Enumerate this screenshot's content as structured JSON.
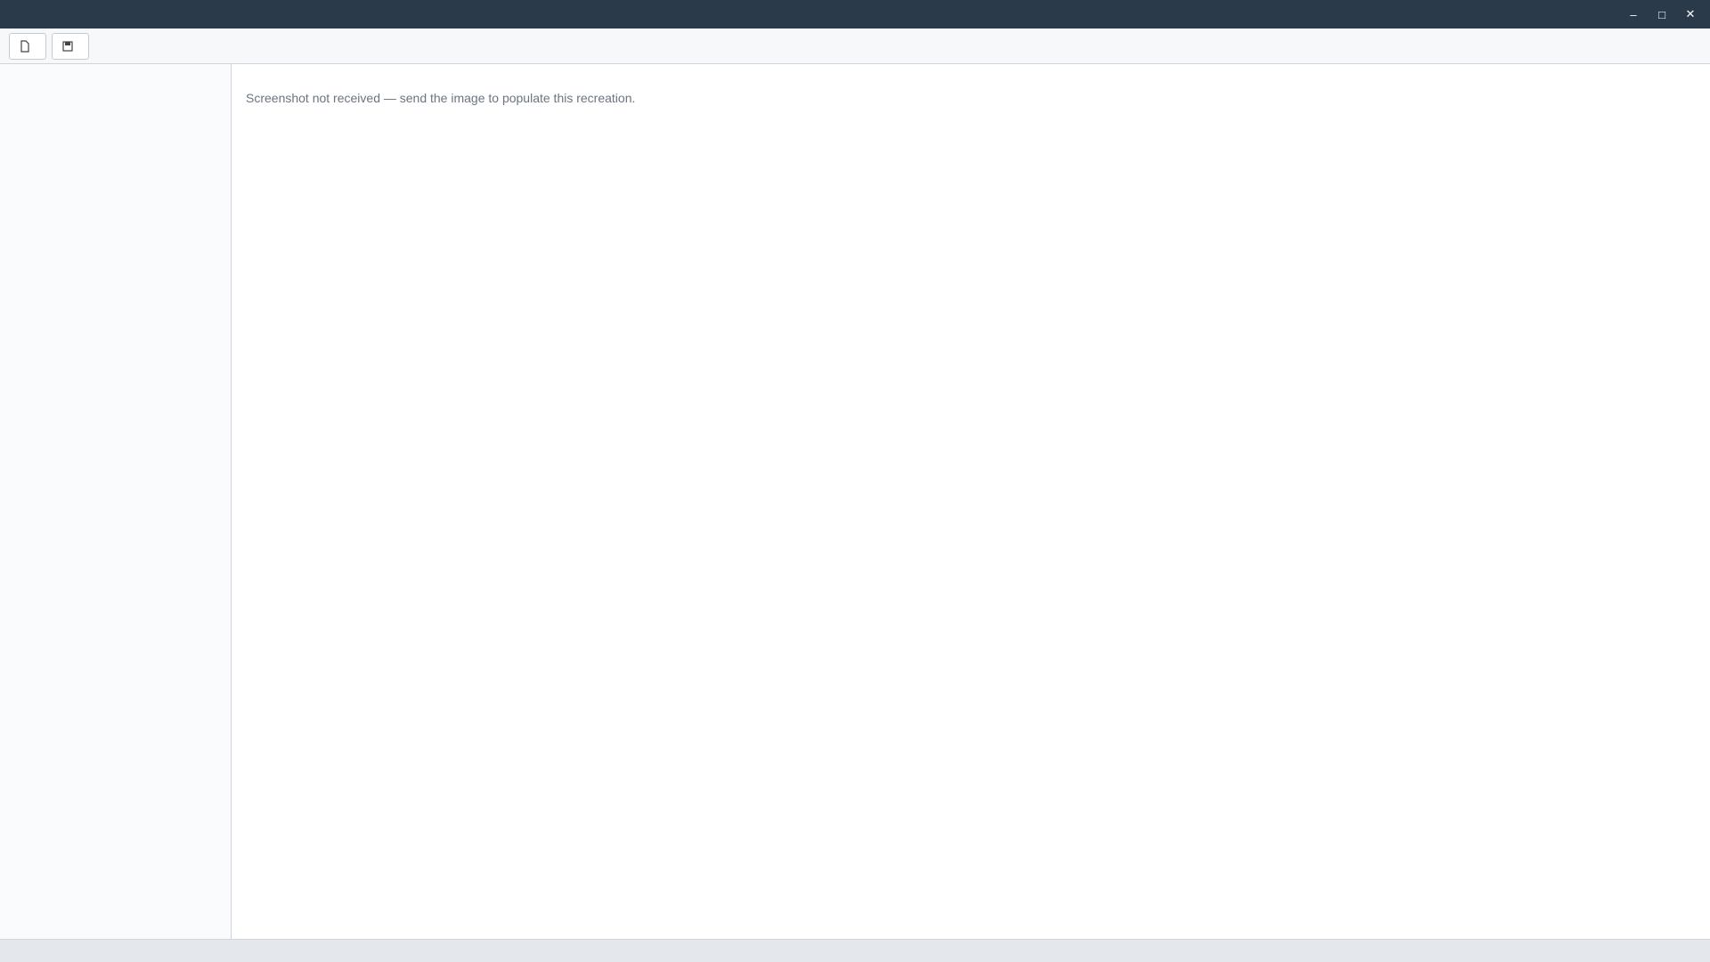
{
  "window": {
    "title": "",
    "minimize_glyph": "–",
    "maximize_glyph": "□",
    "close_glyph": "✕"
  },
  "toolbar": {
    "buttons": [
      {
        "label": "",
        "icon": "file-icon"
      },
      {
        "label": "",
        "icon": "save-icon"
      }
    ]
  },
  "sidebar": {
    "items": [
      {
        "label": ""
      },
      {
        "label": ""
      },
      {
        "label": ""
      }
    ]
  },
  "main": {
    "placeholder": "Screenshot not received — send the image to populate this recreation."
  },
  "statusbar": {
    "text": ""
  }
}
